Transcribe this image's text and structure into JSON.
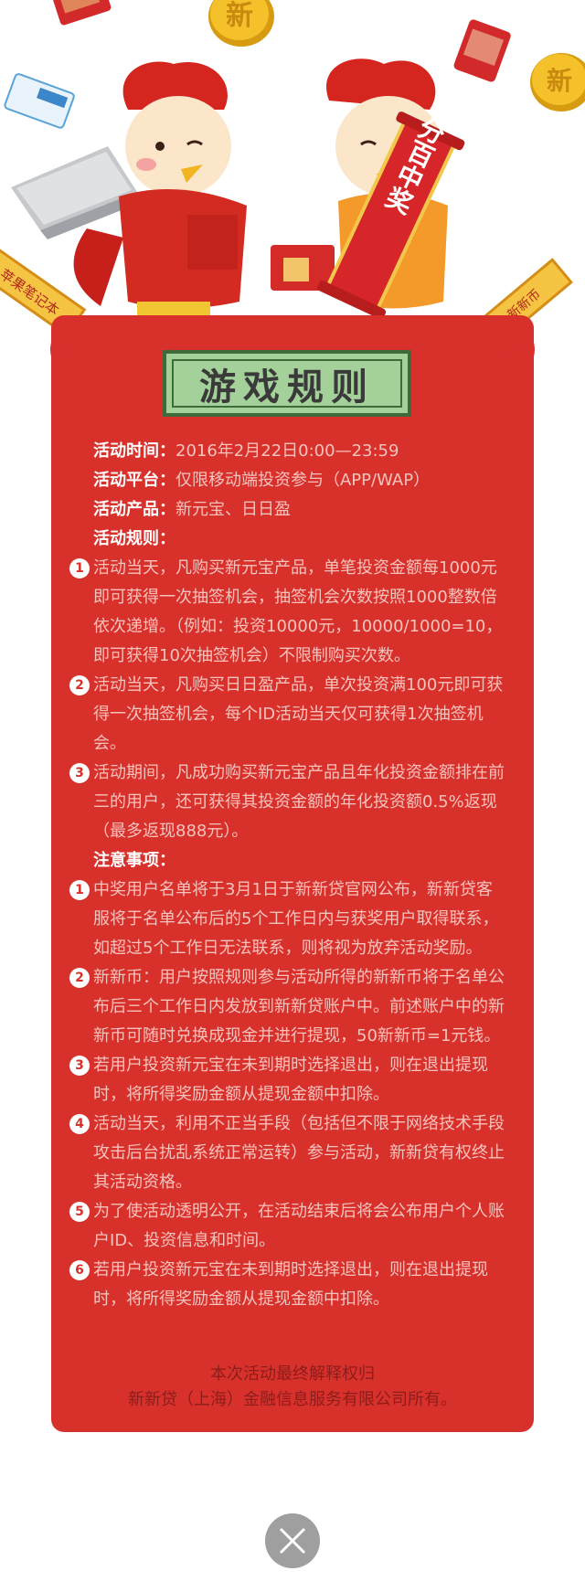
{
  "hero": {
    "coin_char": "新",
    "banner_text": "百分百中奖",
    "left_sign_text": "苹果笔记本",
    "right_sign_text": "新新币"
  },
  "title": "游戏规则",
  "info": [
    {
      "label": "活动时间：",
      "value": "2016年2月22日0:00—23:59"
    },
    {
      "label": "活动平台：",
      "value": "仅限移动端投资参与（APP/WAP）"
    },
    {
      "label": "活动产品：",
      "value": "新元宝、日日盈"
    }
  ],
  "rules_heading": "活动规则：",
  "rules": [
    {
      "num": "1",
      "text": "活动当天，凡购买新元宝产品，单笔投资金额每1000元即可获得一次抽签机会，抽签机会次数按照1000整数倍依次递增。（例如：投资10000元，10000/1000=10，即可获得10次抽签机会）不限制购买次数。"
    },
    {
      "num": "2",
      "text": "活动当天，凡购买日日盈产品，单次投资满100元即可获得一次抽签机会，每个ID活动当天仅可获得1次抽签机会。"
    },
    {
      "num": "3",
      "text": "活动期间，凡成功购买新元宝产品且年化投资金额排在前三的用户，还可获得其投资金额的年化投资额0.5%返现（最多返现888元）。"
    }
  ],
  "notes_heading": "注意事项：",
  "notes": [
    {
      "num": "1",
      "text": "中奖用户名单将于3月1日于新新贷官网公布，新新贷客服将于名单公布后的5个工作日内与获奖用户取得联系，如超过5个工作日无法联系，则将视为放弃活动奖励。"
    },
    {
      "num": "2",
      "text": "新新币：用户按照规则参与活动所得的新新币将于名单公布后三个工作日内发放到新新贷账户中。前述账户中的新新币可随时兑换成现金并进行提现，50新新币=1元钱。"
    },
    {
      "num": "3",
      "text": "若用户投资新元宝在未到期时选择退出，则在退出提现时，将所得奖励金额从提现金额中扣除。"
    },
    {
      "num": "4",
      "text": "活动当天，利用不正当手段（包括但不限于网络技术手段攻击后台扰乱系统正常运转）参与活动，新新贷有权终止其活动资格。"
    },
    {
      "num": "5",
      "text": "为了使活动透明公开，在活动结束后将会公布用户个人账户ID、投资信息和时间。"
    },
    {
      "num": "6",
      "text": "若用户投资新元宝在未到期时选择退出，则在退出提现时，将所得奖励金额从提现金额中扣除。"
    }
  ],
  "footer": {
    "line1": "本次活动最终解释权归",
    "line2": "新新贷（上海）金融信息服务有限公司所有。"
  },
  "colors": {
    "panel": "#d8312c",
    "title_plate": "#a4d19a",
    "body_text": "#f6c3bd",
    "close_button": "#9f9f9f"
  }
}
